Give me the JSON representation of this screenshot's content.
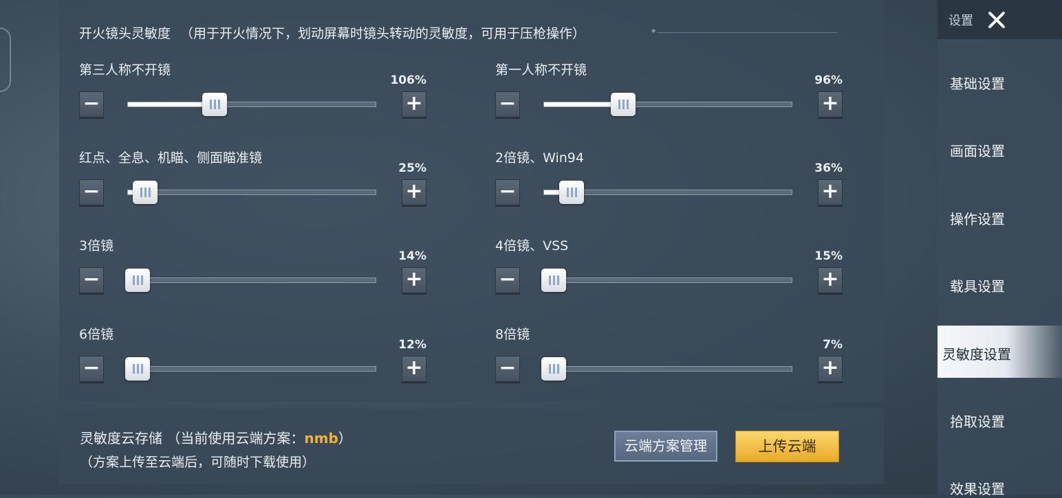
{
  "header": {
    "title": "开火镜头灵敏度",
    "note": "（用于开火情况下，划动屏幕时镜头转动的灵敏度，可用于压枪操作）"
  },
  "sliders": [
    {
      "label": "第三人称不开镜",
      "percent_text": "106%",
      "fill_fraction": 0.35
    },
    {
      "label": "第一人称不开镜",
      "percent_text": "96%",
      "fill_fraction": 0.32
    },
    {
      "label": "红点、全息、机瞄、侧面瞄准镜",
      "percent_text": "25%",
      "fill_fraction": 0.07
    },
    {
      "label": "2倍镜、Win94",
      "percent_text": "36%",
      "fill_fraction": 0.11
    },
    {
      "label": "3倍镜",
      "percent_text": "14%",
      "fill_fraction": 0.04
    },
    {
      "label": "4倍镜、VSS",
      "percent_text": "15%",
      "fill_fraction": 0.04
    },
    {
      "label": "6倍镜",
      "percent_text": "12%",
      "fill_fraction": 0.03
    },
    {
      "label": "8倍镜",
      "percent_text": "7%",
      "fill_fraction": 0.02
    }
  ],
  "stepper": {
    "minus": "−",
    "plus": "+"
  },
  "cloud": {
    "title": "灵敏度云存储",
    "current_prefix": "（当前使用云端方案：",
    "current_plan": "nmb",
    "current_suffix": "）",
    "note": "（方案上传至云端后，可随时下载使用）",
    "manage_button": "云端方案管理",
    "upload_button": "上传云端"
  },
  "sidebar": {
    "title": "设置",
    "items": [
      {
        "label": "基础设置",
        "active": false
      },
      {
        "label": "画面设置",
        "active": false
      },
      {
        "label": "操作设置",
        "active": false
      },
      {
        "label": "载具设置",
        "active": false
      },
      {
        "label": "灵敏度设置",
        "active": true
      },
      {
        "label": "拾取设置",
        "active": false
      },
      {
        "label": "效果设置",
        "active": false
      }
    ]
  },
  "icons": {
    "close": "close-icon",
    "minus": "minus-icon",
    "plus": "plus-icon"
  },
  "colors": {
    "accent_plan": "#f0b23a",
    "upload_button": "#f5c04a"
  }
}
